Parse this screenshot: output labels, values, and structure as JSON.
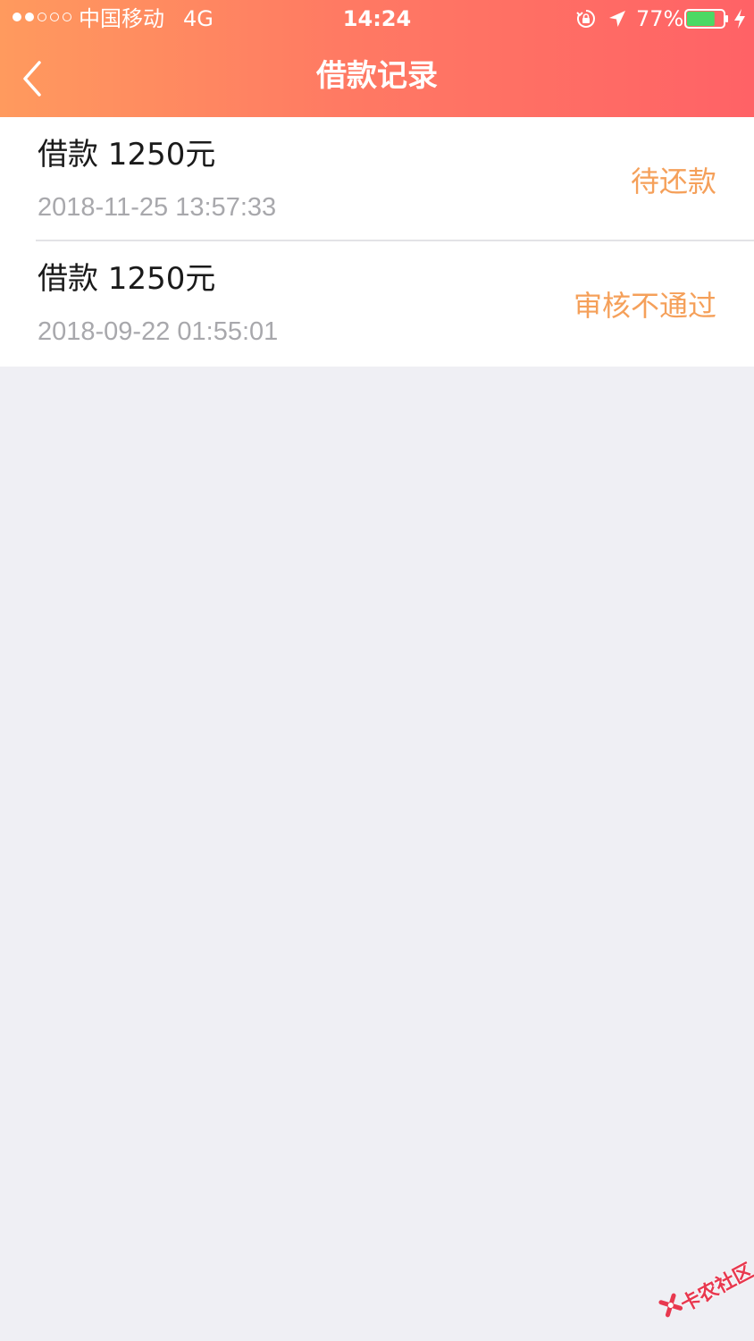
{
  "status_bar": {
    "carrier": "中国移动",
    "network": "4G",
    "time": "14:24",
    "battery_percent": "77%",
    "battery_level": 0.77,
    "signal_bars_filled": 2,
    "signal_bars_total": 5,
    "icons": [
      "orientation-lock-icon",
      "location-arrow-icon",
      "battery-icon",
      "charging-bolt-icon"
    ]
  },
  "nav": {
    "title": "借款记录",
    "back_icon": "chevron-left-icon"
  },
  "loans": [
    {
      "title": "借款 1250元",
      "time": "2018-11-25 13:57:33",
      "status": "待还款"
    },
    {
      "title": "借款 1250元",
      "time": "2018-09-22 01:55:01",
      "status": "审核不通过"
    }
  ],
  "colors": {
    "header_gradient_start": "#ff9a5e",
    "header_gradient_end": "#ff6266",
    "status_text": "#f5a05a",
    "background": "#efeff4",
    "battery_fill": "#4cd964",
    "watermark": "#e8384f"
  },
  "watermark": {
    "text": "卡农社区"
  }
}
